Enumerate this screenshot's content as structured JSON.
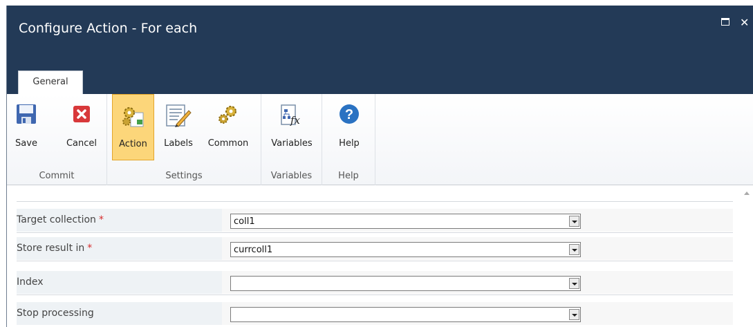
{
  "window": {
    "title": "Configure Action - For each"
  },
  "tabs": [
    {
      "label": "General"
    }
  ],
  "ribbon": {
    "groups": [
      {
        "label": "Commit",
        "buttons": [
          {
            "label": "Save",
            "icon": "save-icon"
          },
          {
            "label": "Cancel",
            "icon": "cancel-icon"
          }
        ]
      },
      {
        "label": "Settings",
        "buttons": [
          {
            "label": "Action",
            "icon": "action-gears-icon",
            "active": true
          },
          {
            "label": "Labels",
            "icon": "labels-icon"
          },
          {
            "label": "Common",
            "icon": "common-gears-icon"
          }
        ]
      },
      {
        "label": "Variables",
        "buttons": [
          {
            "label": "Variables",
            "icon": "variables-fx-icon"
          }
        ]
      },
      {
        "label": "Help",
        "buttons": [
          {
            "label": "Help",
            "icon": "help-icon"
          }
        ]
      }
    ]
  },
  "form": {
    "required_mark": "*",
    "fields": [
      {
        "label": "Target collection",
        "required": true,
        "value": "coll1"
      },
      {
        "label": "Store result in",
        "required": true,
        "value": "currcoll1"
      },
      {
        "label": "Index",
        "required": false,
        "value": ""
      },
      {
        "label": "Stop processing",
        "required": false,
        "value": ""
      }
    ]
  },
  "colors": {
    "titlebar": "#233a57",
    "active_button": "#fcd67a",
    "required": "#d62c2c"
  }
}
